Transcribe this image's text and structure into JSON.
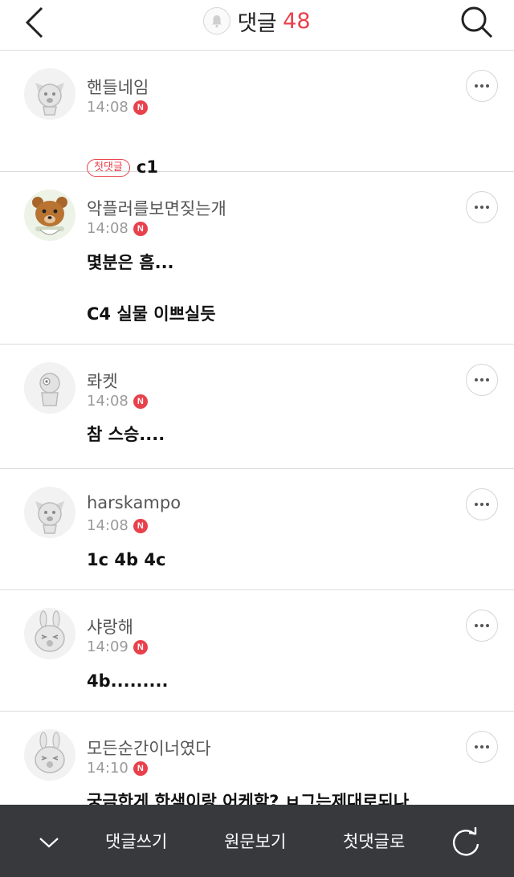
{
  "header": {
    "title": "댓글",
    "count": "48"
  },
  "comments": [
    {
      "username": "핸들네임",
      "time": "14:08",
      "badge": "N",
      "tag": "첫댓글",
      "text": "c1"
    },
    {
      "username": "악플러를보면짖는개",
      "time": "14:08",
      "badge": "N",
      "text": "몇분은 흠...\n\nC4 실물 이쁘실듯"
    },
    {
      "username": "롸켓",
      "time": "14:08",
      "badge": "N",
      "text": "참 스승...."
    },
    {
      "username": "harskampo",
      "time": "14:08",
      "badge": "N",
      "text": "1c  4b 4c"
    },
    {
      "username": "샤랑해",
      "time": "14:09",
      "badge": "N",
      "text": "4b........."
    },
    {
      "username": "모든순간이너였다",
      "time": "14:10",
      "badge": "N",
      "text": "궁금한게 한색이랑 어케함? ㅂ그는제대로되나"
    }
  ],
  "bottom_bar": {
    "write": "댓글쓰기",
    "original": "원문보기",
    "first_comment": "첫댓글로"
  },
  "colors": {
    "accent": "#e8414c",
    "bottom_bar": "#38393d",
    "divider": "#dcdcdc"
  }
}
